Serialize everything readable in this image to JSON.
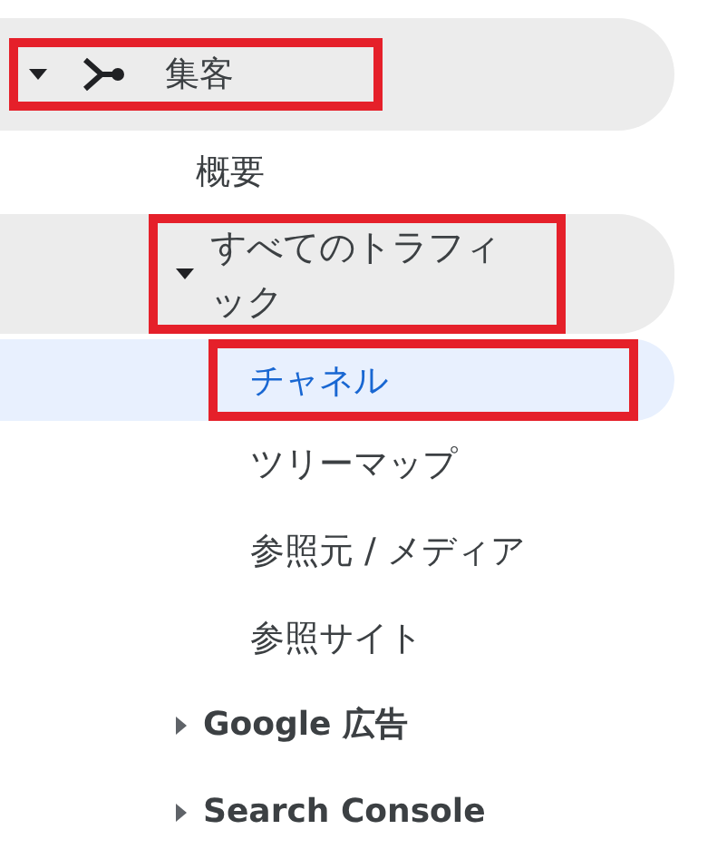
{
  "nav": [
    {
      "kind": "section",
      "label": "集客",
      "expanded": true,
      "highlighted": true,
      "children": [
        {
          "kind": "item",
          "label": "概要",
          "selected": false,
          "highlighted": false
        },
        {
          "kind": "group",
          "label": "すべてのトラフィック",
          "expanded": true,
          "highlighted": true,
          "children": [
            {
              "kind": "item",
              "label": "チャネル",
              "selected": true,
              "highlighted": true
            },
            {
              "kind": "item",
              "label": "ツリーマップ",
              "selected": false,
              "highlighted": false
            },
            {
              "kind": "item",
              "label": "参照元 / メディア",
              "selected": false,
              "highlighted": false
            },
            {
              "kind": "item",
              "label": "参照サイト",
              "selected": false,
              "highlighted": false
            }
          ]
        },
        {
          "kind": "group",
          "label": "Google 広告",
          "expanded": false
        },
        {
          "kind": "group",
          "label": "Search Console",
          "expanded": false
        }
      ]
    }
  ]
}
